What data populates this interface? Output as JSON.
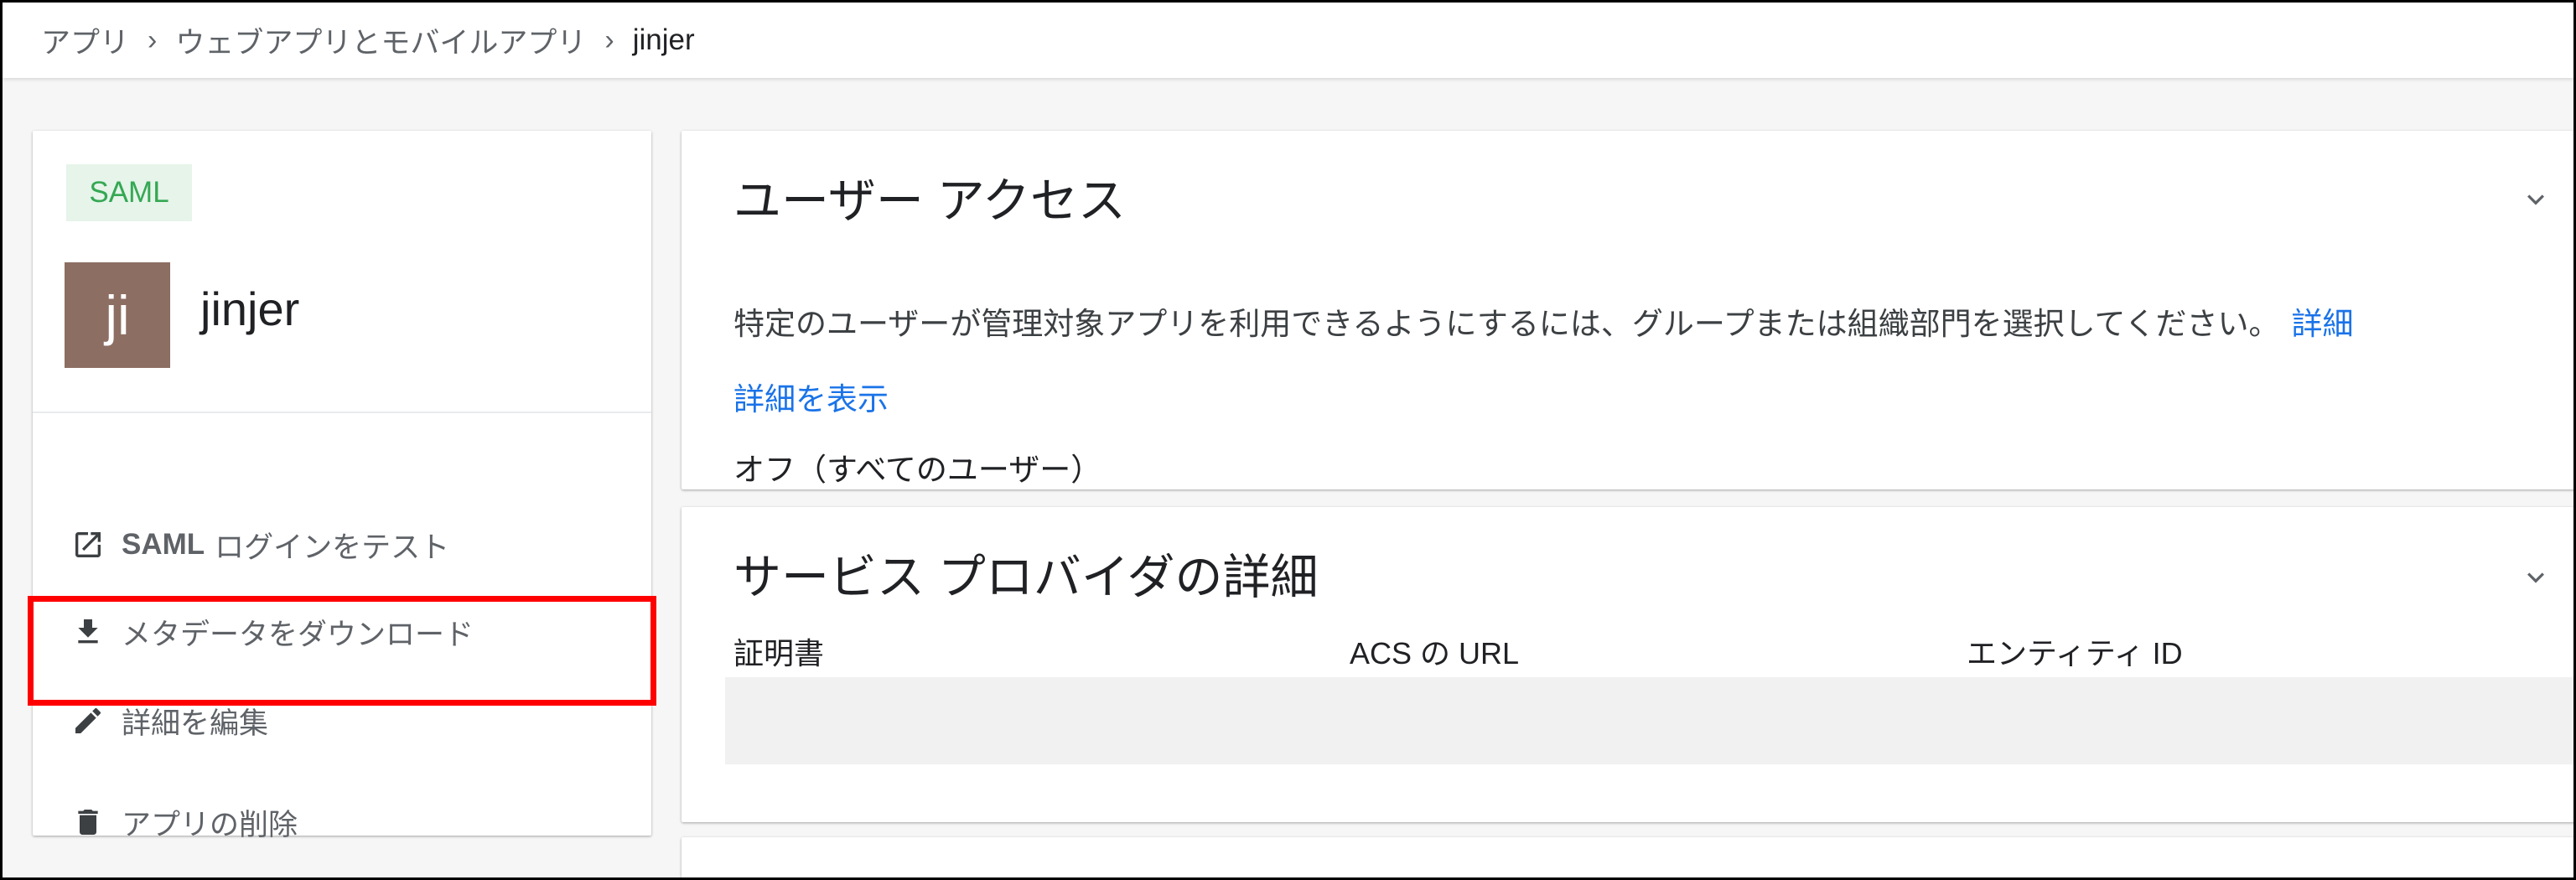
{
  "breadcrumb": {
    "items": [
      "アプリ",
      "ウェブアプリとモバイルアプリ"
    ],
    "current": "jinjer",
    "separator": "›"
  },
  "app": {
    "badge": "SAML",
    "avatar_initials": "ji",
    "name": "jinjer"
  },
  "menu": {
    "test_login_bold": "SAML",
    "test_login_rest": "ログインをテスト",
    "download_metadata": "メタデータをダウンロード",
    "edit_details": "詳細を編集",
    "delete_app": "アプリの削除"
  },
  "user_access": {
    "title": "ユーザー アクセス",
    "description": "特定のユーザーが管理対象アプリを利用できるようにするには、グループまたは組織部門を選択してください。",
    "learn_more": "詳細",
    "show_details": "詳細を表示",
    "status": "オフ（すべてのユーザー）"
  },
  "service_provider": {
    "title": "サービス プロバイダの詳細",
    "columns": [
      "証明書",
      "ACS の URL",
      "エンティティ ID"
    ]
  },
  "colors": {
    "highlight": "#ff0000",
    "link": "#1a73e8",
    "badge_bg": "#e6f4ea",
    "badge_text": "#34a853",
    "avatar_bg": "#8d6e63"
  }
}
